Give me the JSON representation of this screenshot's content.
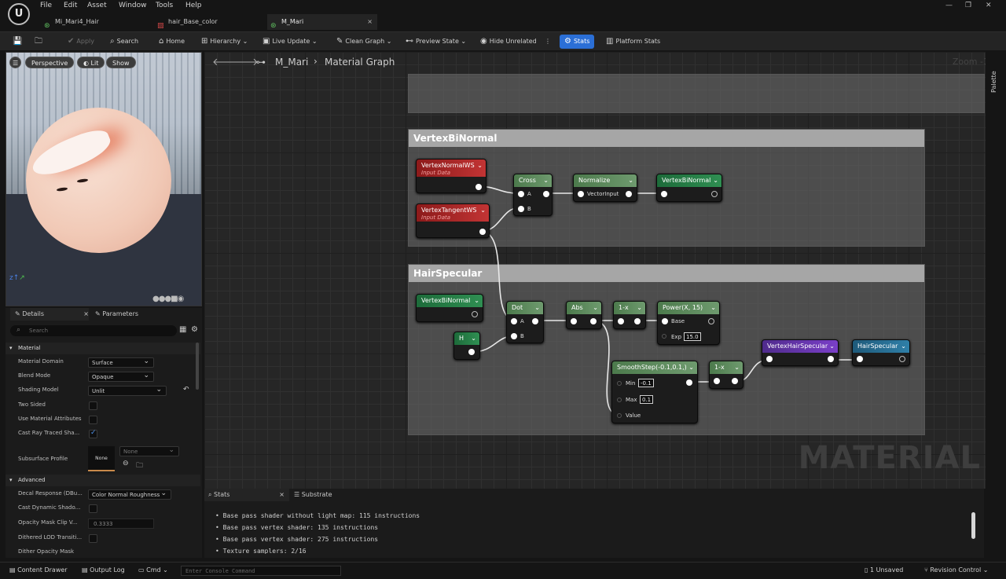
{
  "menu": [
    "File",
    "Edit",
    "Asset",
    "Window",
    "Tools",
    "Help"
  ],
  "tabs": [
    {
      "label": "Mi_Mari4_Hair",
      "icon": "material-instance-icon"
    },
    {
      "label": "hair_Base_color",
      "icon": "texture-icon"
    },
    {
      "label": "M_Mari",
      "icon": "material-icon"
    }
  ],
  "toolbar": {
    "apply": "Apply",
    "search": "Search",
    "home": "Home",
    "hierarchy": "Hierarchy",
    "live_update": "Live Update",
    "clean_graph": "Clean Graph",
    "preview_state": "Preview State",
    "hide_unrelated": "Hide Unrelated",
    "stats": "Stats",
    "platform_stats": "Platform Stats"
  },
  "viewport": {
    "perspective": "Perspective",
    "lit": "Lit",
    "show": "Show"
  },
  "details": {
    "tab_details": "Details",
    "tab_parameters": "Parameters",
    "search_placeholder": "Search",
    "section_material": "Material",
    "section_advanced": "Advanced",
    "material_domain_label": "Material Domain",
    "material_domain": "Surface",
    "blend_mode_label": "Blend Mode",
    "blend_mode": "Opaque",
    "shading_model_label": "Shading Model",
    "shading_model": "Unlit",
    "two_sided_label": "Two Sided",
    "use_mat_attr_label": "Use Material Attributes",
    "cast_ray_label": "Cast Ray Traced Sha...",
    "subsurface_label": "Subsurface Profile",
    "subsurface_thumb": "None",
    "subsurface_value": "None",
    "decal_label": "Decal Response (DBu...",
    "decal_value": "Color Normal Roughness",
    "cast_dyn_label": "Cast Dynamic Shado...",
    "opacity_clip_label": "Opacity Mask Clip V...",
    "opacity_clip_value": "0.3333",
    "dithered_label": "Dithered LOD Transiti...",
    "dither_opacity_label": "Dither Opacity Mask"
  },
  "graph": {
    "breadcrumb_root": "M_Mari",
    "breadcrumb_sub": "Material Graph",
    "zoom": "Zoom -1",
    "watermark": "MATERIAL",
    "palette": "Palette",
    "comment1": "VertexBiNormal",
    "comment2": "HairSpecular",
    "nodes": {
      "vnws": "VertexNormalWS",
      "vnws_sub": "Input Data",
      "vtws": "VertexTangentWS",
      "vtws_sub": "Input Data",
      "cross": "Cross",
      "pin_a": "A",
      "pin_b": "B",
      "normalize": "Normalize",
      "vector_input": "VectorInput",
      "vbn_out": "VertexBiNormal",
      "vbn_in": "VertexBiNormal",
      "h": "H",
      "dot": "Dot",
      "abs": "Abs",
      "one_minus": "1-x",
      "power": "Power(X, 15)",
      "base": "Base",
      "exp": "Exp",
      "exp_val": "15.0",
      "smooth": "SmoothStep(-0.1,0.1,)",
      "min": "Min",
      "min_val": "-0.1",
      "max": "Max",
      "max_val": "0.1",
      "value": "Value",
      "one_minus2": "1-x",
      "vhs": "VertexHairSpecular",
      "hs": "HairSpecular"
    }
  },
  "stats": {
    "tab_stats": "Stats",
    "tab_substrate": "Substrate",
    "lines": [
      "Base pass shader without light map: 115 instructions",
      "Base pass vertex shader: 135 instructions",
      "Base pass vertex shader: 275 instructions",
      "Texture samplers: 2/16"
    ]
  },
  "status": {
    "content_drawer": "Content Drawer",
    "output_log": "Output Log",
    "cmd": "Cmd",
    "console_placeholder": "Enter Console Command",
    "unsaved": "1 Unsaved",
    "revision": "Revision Control"
  }
}
